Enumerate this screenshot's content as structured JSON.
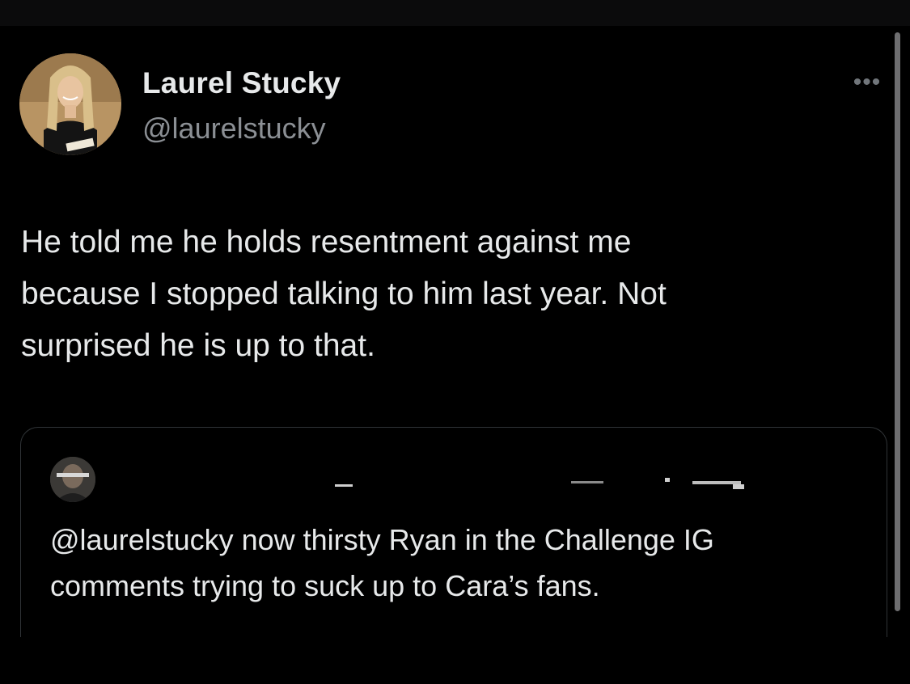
{
  "tweet": {
    "author": {
      "display_name": "Laurel Stucky",
      "handle": "@laurelstucky",
      "avatar_icon": "profile-photo"
    },
    "more_icon": "more-dots-icon",
    "more_glyph": "•••",
    "text_lines": [
      "He told me he holds resentment against me",
      "because I stopped talking to him last year. Not",
      "surprised he is up to that."
    ],
    "quote": {
      "avatar_icon": "profile-photo",
      "text_lines": [
        "@laurelstucky now thirsty Ryan in the Challenge IG",
        "comments trying to suck up to Cara’s fans."
      ]
    }
  },
  "colors": {
    "background": "#000000",
    "primary_text": "#e7e9ea",
    "secondary_text": "#8b8f94",
    "border": "#2f3336"
  }
}
